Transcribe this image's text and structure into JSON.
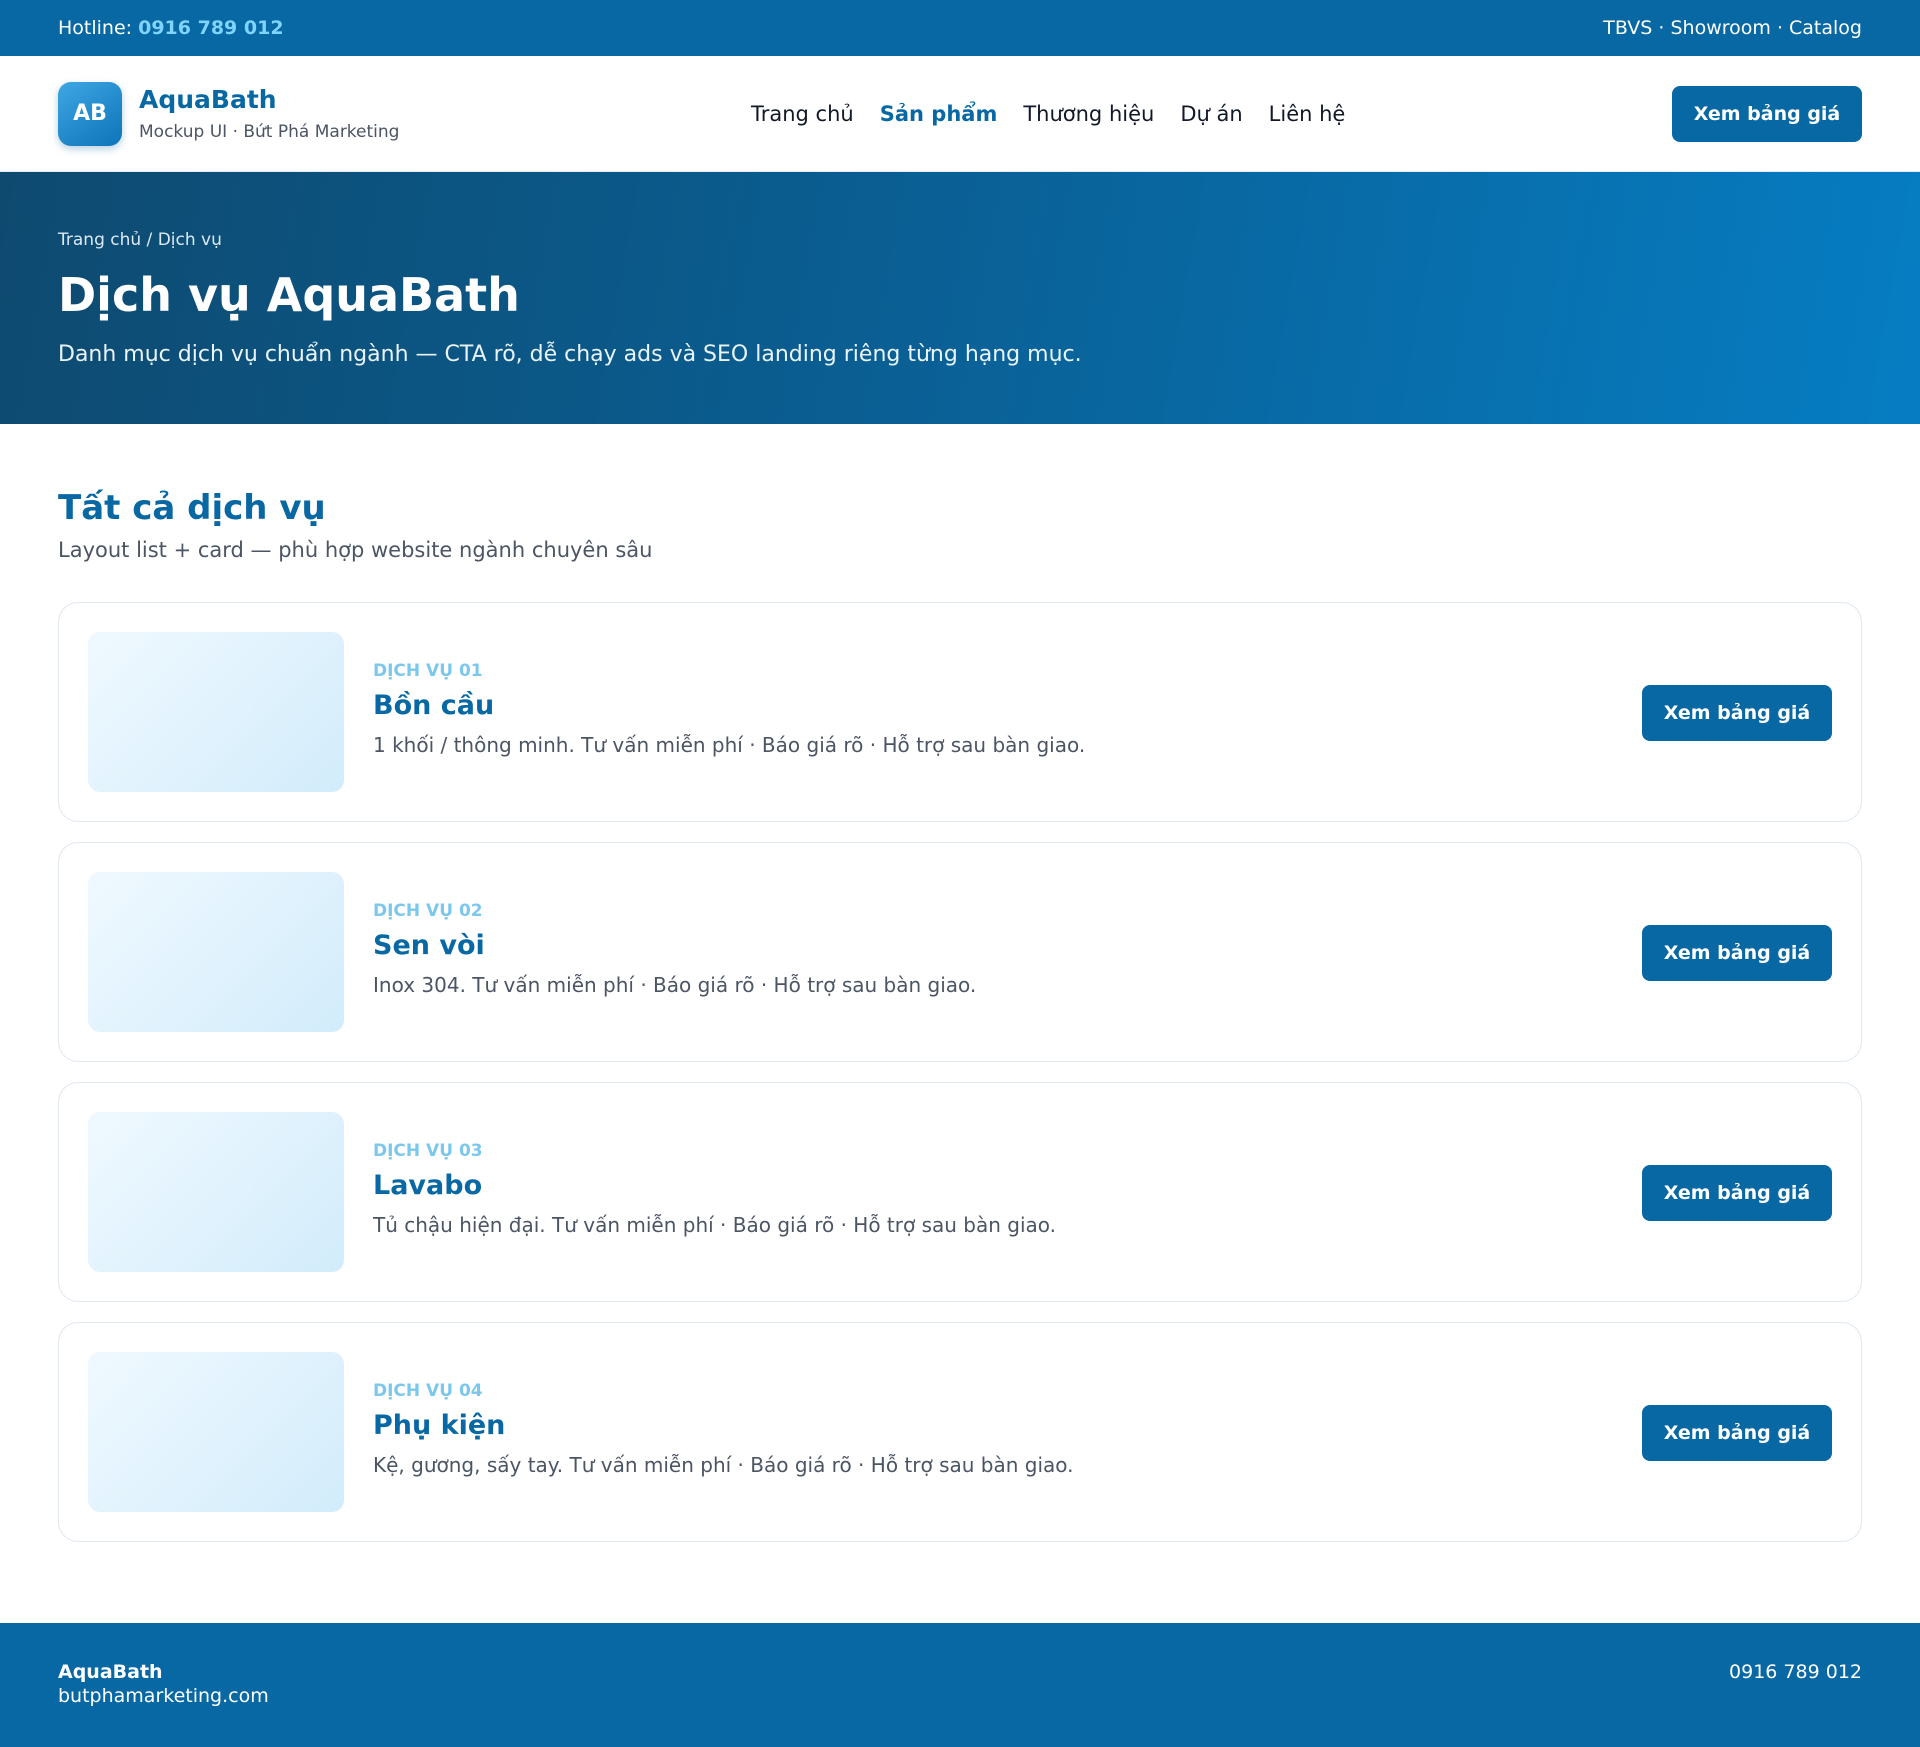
{
  "topbar": {
    "hotline_label": "Hotline:",
    "hotline_number": "0916 789 012",
    "links": "TBVS · Showroom · Catalog"
  },
  "header": {
    "logo_initials": "AB",
    "brand_name": "AquaBath",
    "brand_sub": "Mockup UI · Bứt Phá Marketing",
    "nav": [
      {
        "label": "Trang chủ"
      },
      {
        "label": "Sản phẩm"
      },
      {
        "label": "Thương hiệu"
      },
      {
        "label": "Dự án"
      },
      {
        "label": "Liên hệ"
      }
    ],
    "cta_label": "Xem bảng giá"
  },
  "hero": {
    "breadcrumb": "Trang chủ / Dịch vụ",
    "title": "Dịch vụ AquaBath",
    "description": "Danh mục dịch vụ chuẩn ngành — CTA rõ, dễ chạy ads và SEO landing riêng từng hạng mục."
  },
  "section": {
    "title": "Tất cả dịch vụ",
    "subtitle": "Layout list + card — phù hợp website ngành chuyên sâu"
  },
  "services": [
    {
      "tag": "DỊCH VỤ 01",
      "title": "Bồn cầu",
      "desc": "1 khối / thông minh. Tư vấn miễn phí · Báo giá rõ · Hỗ trợ sau bàn giao.",
      "cta": "Xem bảng giá"
    },
    {
      "tag": "DỊCH VỤ 02",
      "title": "Sen vòi",
      "desc": "Inox 304. Tư vấn miễn phí · Báo giá rõ · Hỗ trợ sau bàn giao.",
      "cta": "Xem bảng giá"
    },
    {
      "tag": "DỊCH VỤ 03",
      "title": "Lavabo",
      "desc": "Tủ chậu hiện đại. Tư vấn miễn phí · Báo giá rõ · Hỗ trợ sau bàn giao.",
      "cta": "Xem bảng giá"
    },
    {
      "tag": "DỊCH VỤ 04",
      "title": "Phụ kiện",
      "desc": "Kệ, gương, sấy tay. Tư vấn miễn phí · Báo giá rõ · Hỗ trợ sau bàn giao.",
      "cta": "Xem bảng giá"
    }
  ],
  "footer": {
    "brand": "AquaBath",
    "website": "butphamarketing.com",
    "phone": "0916 789 012"
  },
  "colors": {
    "primary": "#0868a3",
    "accent_light": "#7fd4ff",
    "tag": "#7cc7ec"
  }
}
